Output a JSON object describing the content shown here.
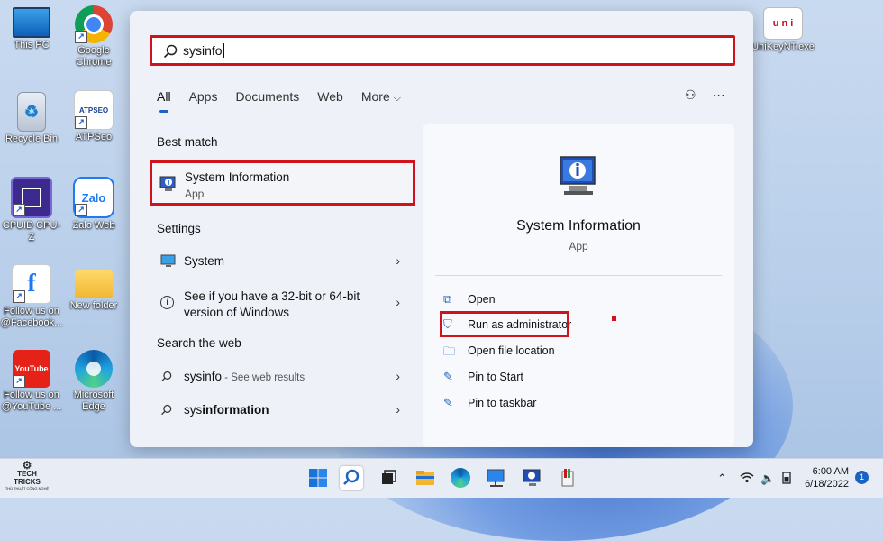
{
  "desktop": {
    "icons": [
      {
        "label": "This PC"
      },
      {
        "label": "Google Chrome"
      },
      {
        "label": "Recycle Bin"
      },
      {
        "label": "ATPSeo"
      },
      {
        "label": "CPUID CPU-Z"
      },
      {
        "label": "Zalo Web"
      },
      {
        "label": "Follow us on @Facebook..."
      },
      {
        "label": "New folder"
      },
      {
        "label": "Follow us on @YouTube ..."
      },
      {
        "label": "Microsoft Edge"
      },
      {
        "label": "UniKeyNT.exe"
      }
    ],
    "atpseo_logo_text": "ATPSEO",
    "zalo_logo_text": "Zalo",
    "youtube_logo_text": "YouTube"
  },
  "search": {
    "query": "sysinfo",
    "tabs": [
      "All",
      "Apps",
      "Documents",
      "Web",
      "More"
    ],
    "active_tab": "All"
  },
  "results": {
    "best_match_heading": "Best match",
    "best_match": {
      "title": "System Information",
      "type": "App"
    },
    "settings_heading": "Settings",
    "settings": [
      {
        "label": "System"
      },
      {
        "label": "See if you have a 32-bit or 64-bit",
        "label2": "version of Windows"
      }
    ],
    "web_heading": "Search the web",
    "web": [
      {
        "label": "sysinfo",
        "suffix": " - See web results"
      },
      {
        "prefix": "sys",
        "bold": "information"
      }
    ]
  },
  "detail": {
    "title": "System Information",
    "subtitle": "App",
    "actions": [
      {
        "label": "Open",
        "icon": "open-icon"
      },
      {
        "label": "Run as administrator",
        "icon": "shield-icon"
      },
      {
        "label": "Open file location",
        "icon": "folder-icon"
      },
      {
        "label": "Pin to Start",
        "icon": "pin-icon"
      },
      {
        "label": "Pin to taskbar",
        "icon": "pin-icon"
      }
    ]
  },
  "taskbar": {
    "time": "6:00 AM",
    "date": "6/18/2022",
    "notification_count": "1",
    "brand_line1": "TECH TRICKS",
    "brand_line2": "THỦ THUẬT CÔNG NGHỆ"
  },
  "colors": {
    "highlight": "#d0121b",
    "accent": "#1a63c4"
  }
}
